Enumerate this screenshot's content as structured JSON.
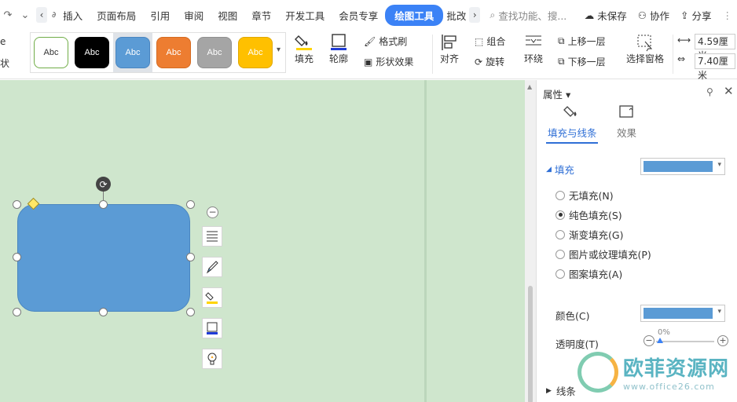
{
  "menubar": {
    "tabs": [
      {
        "label": "插入"
      },
      {
        "label": "页面布局"
      },
      {
        "label": "引用"
      },
      {
        "label": "审阅"
      },
      {
        "label": "视图"
      },
      {
        "label": "章节"
      },
      {
        "label": "开发工具"
      },
      {
        "label": "会员专享"
      },
      {
        "label": "绘图工具",
        "active": true
      },
      {
        "label": "批改"
      }
    ],
    "search_placeholder": "查找功能、搜...",
    "unsaved": "未保存",
    "collab": "协作",
    "share": "分享"
  },
  "ribbon": {
    "edge_top": "e",
    "edge_bottom": "状",
    "styles": [
      {
        "label": "Abc",
        "bg": "#ffffff",
        "fg": "#333333",
        "border": "#70ad47"
      },
      {
        "label": "Abc",
        "bg": "#000000",
        "fg": "#ffffff",
        "border": "#000000"
      },
      {
        "label": "Abc",
        "bg": "#5b9bd5",
        "fg": "#ffffff",
        "border": "#4a86c0"
      },
      {
        "label": "Abc",
        "bg": "#ed7d31",
        "fg": "#ffffff",
        "border": "#d46b22"
      },
      {
        "label": "Abc",
        "bg": "#a5a5a5",
        "fg": "#ffffff",
        "border": "#909090"
      },
      {
        "label": "Abc",
        "bg": "#ffc000",
        "fg": "#ffffff",
        "border": "#e0a800"
      }
    ],
    "fill": "填充",
    "outline": "轮廓",
    "format_painter": "格式刷",
    "shape_effects": "形状效果",
    "align": "对齐",
    "group": "组合",
    "rotate": "旋转",
    "wrap": "环绕",
    "bring_forward": "上移一层",
    "send_backward": "下移一层",
    "selection_pane": "选择窗格",
    "height": "4.59厘米",
    "width": "7.40厘米"
  },
  "panel": {
    "title": "属性",
    "tab_fill_line": "填充与线条",
    "tab_effects": "效果",
    "fill_section": "填充",
    "fill_color": "#5b9bd5",
    "options": [
      {
        "label": "无填充(N)",
        "checked": false
      },
      {
        "label": "纯色填充(S)",
        "checked": true
      },
      {
        "label": "渐变填充(G)",
        "checked": false
      },
      {
        "label": "图片或纹理填充(P)",
        "checked": false
      },
      {
        "label": "图案填充(A)",
        "checked": false
      }
    ],
    "color_label": "颜色(C)",
    "transparency_label": "透明度(T)",
    "transparency_value": "0%",
    "line_section": "线条"
  },
  "watermark": {
    "name": "欧菲资源网",
    "url": "www.office26.com"
  }
}
